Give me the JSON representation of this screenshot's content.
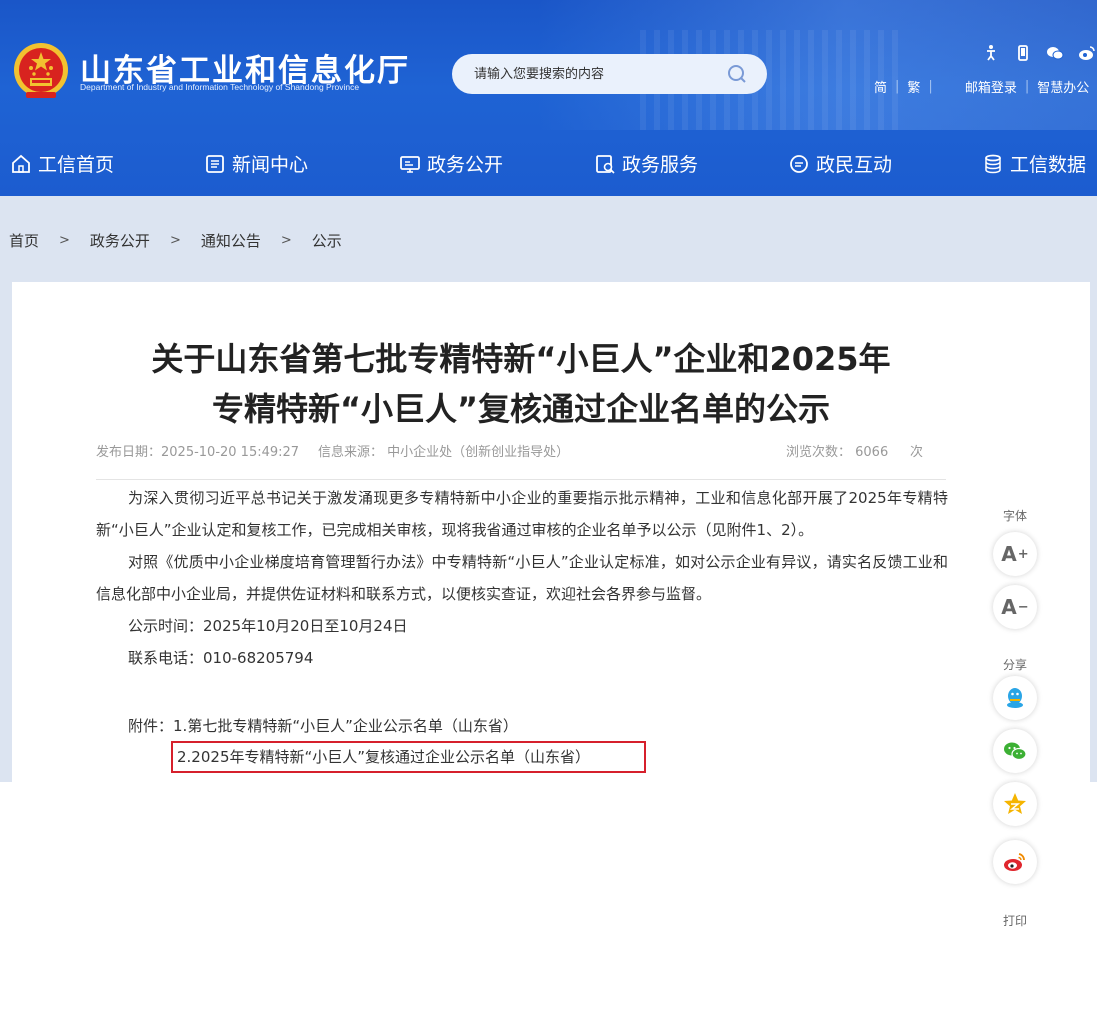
{
  "header": {
    "site_title": "山东省工业和信息化厅",
    "site_subtitle": "Department of Industry and Information Technology of Shandong Province",
    "search_placeholder": "请输入您要搜索的内容",
    "top_links": [
      "简",
      "繁",
      "邮箱登录",
      "智慧办公"
    ],
    "top_icons": [
      "accessibility-icon",
      "mobile-icon",
      "wechat-icon",
      "weibo-icon"
    ],
    "nav": [
      {
        "label": "工信首页",
        "icon": "home-icon"
      },
      {
        "label": "新闻中心",
        "icon": "news-icon"
      },
      {
        "label": "政务公开",
        "icon": "monitor-icon"
      },
      {
        "label": "政务服务",
        "icon": "service-icon"
      },
      {
        "label": "政民互动",
        "icon": "chat-icon"
      },
      {
        "label": "工信数据",
        "icon": "database-icon"
      }
    ]
  },
  "breadcrumb": [
    "首页",
    "政务公开",
    "通知公告",
    "公示"
  ],
  "breadcrumb_separator": ">",
  "article": {
    "title_line1": "关于山东省第七批专精特新“小巨人”企业和2025年",
    "title_line2": "专精特新“小巨人”复核通过企业名单的公示",
    "publish_date": "发布日期：2025-10-20 15:49:27",
    "source": "信息来源： 中小企业处（创新创业指导处）",
    "views": "浏览次数： 6066",
    "views_unit": "次",
    "paragraphs": [
      "为深入贯彻习近平总书记关于激发涌现更多专精特新中小企业的重要指示批示精神，工业和信息化部开展了2025年专精特新“小巨人”企业认定和复核工作，已完成相关审核，现将我省通过审核的企业名单予以公示（见附件1、2）。",
      "对照《优质中小企业梯度培育管理暂行办法》中专精特新“小巨人”企业认定标准，如对公示企业有异议，请实名反馈工业和信息化部中小企业局，并提供佐证材料和联系方式，以便核实查证，欢迎社会各界参与监督。",
      "公示时间：2025年10月20日至10月24日",
      "联系电话：010-68205794"
    ],
    "attachment_prefix": "附件：",
    "attachment1": "1.第七批专精特新“小巨人”企业公示名单（山东省）",
    "attachment2": "2.2025年专精特新“小巨人”复核通过企业公示名单（山东省）"
  },
  "side_tools": {
    "font_label": "字体",
    "font_increase": "A",
    "font_decrease": "A",
    "share_label": "分享",
    "share_icons": [
      "qq-icon",
      "wechat-share-icon",
      "qzone-icon",
      "weibo-share-icon"
    ],
    "print_label": "打印"
  },
  "colors": {
    "header_blue": "#1f63d4",
    "crumb_bg": "#dce4f1",
    "highlight_border": "#d6202c"
  }
}
